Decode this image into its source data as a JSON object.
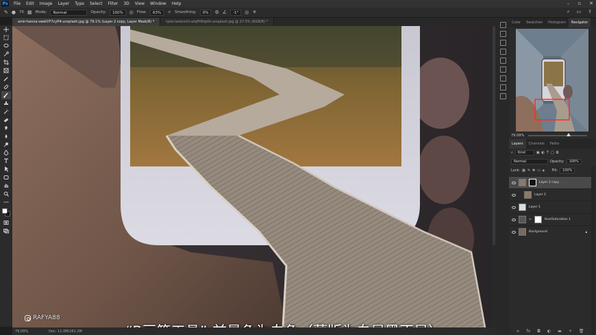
{
  "app": {
    "logo": "Ps"
  },
  "menu": [
    "File",
    "Edit",
    "Image",
    "Layer",
    "Type",
    "Select",
    "Filter",
    "3D",
    "View",
    "Window",
    "Help"
  ],
  "options": {
    "mode_label": "Mode:",
    "mode_value": "Normal",
    "opacity_label": "Opacity:",
    "opacity_value": "100%",
    "flow_label": "Flow:",
    "flow_value": "63%",
    "smoothing_label": "Smoothing:",
    "smoothing_value": "0%",
    "angle_value": "-1°",
    "brush_size": "70"
  },
  "tabs": [
    {
      "label": "amir-hanna-swetVF7cyP4-unsplash.jpg @ 79.1% (Layer 2 copy, Layer Mask/8) *",
      "active": true
    },
    {
      "label": "tyler-lastovich-etqPt9hp0k-unsplash.jpg @ 27.5% (RGB/8) *",
      "active": false
    }
  ],
  "canvas": {
    "caption": "“B画笔工具”-前景色为白色（蒙版为白显黑不显）",
    "watermark": "RAFYA88"
  },
  "status": {
    "zoom": "79.09%",
    "doc": "Doc: 11.0M/261.2M"
  },
  "panel": {
    "top_tabs": [
      "Color",
      "Swatches",
      "Histogram",
      "Navigator"
    ],
    "active_top_tab": "Navigator",
    "nav_zoom": "79.09%",
    "layer_tabs": [
      "Layers",
      "Channels",
      "Paths"
    ],
    "kind_label": "Kind",
    "blend_mode": "Normal",
    "opacity_label": "Opacity:",
    "opacity_value": "100%",
    "lock_label": "Lock:",
    "fill_label": "Fill:",
    "fill_value": "100%",
    "layers": [
      {
        "name": "Layer 2 copy",
        "active": true
      },
      {
        "name": "Layer 2",
        "active": false
      },
      {
        "name": "Layer 1",
        "active": false
      },
      {
        "name": "Hue/Saturation 1",
        "active": false
      },
      {
        "name": "Background",
        "active": false
      }
    ]
  },
  "colors": {
    "accent": "#31a8ff",
    "ui_bg": "#2b2b2b",
    "selection": "#4a4a4a"
  }
}
